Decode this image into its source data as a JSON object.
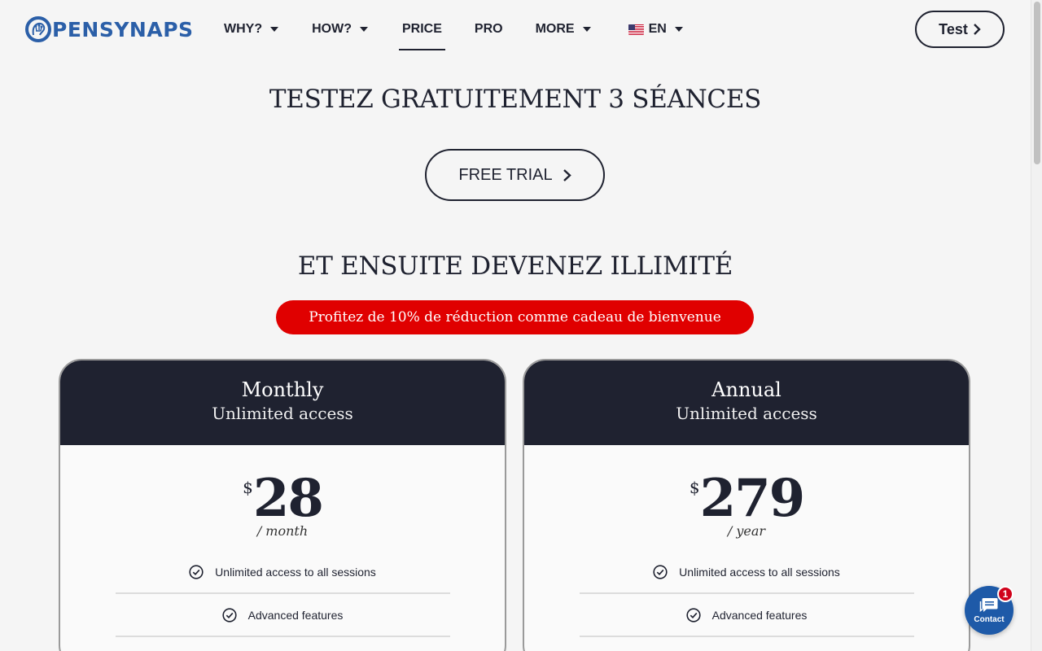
{
  "brand": {
    "name": "PENSYNAPS",
    "logo_letter": "O",
    "color": "#2b5fa8"
  },
  "nav": {
    "items": [
      {
        "label": "WHY?",
        "dropdown": true
      },
      {
        "label": "HOW?",
        "dropdown": true
      },
      {
        "label": "PRICE",
        "active": true
      },
      {
        "label": "PRO"
      },
      {
        "label": "MORE",
        "dropdown": true
      }
    ],
    "language": "EN",
    "language_flag": "us-flag-icon"
  },
  "header_button": {
    "label": "Test"
  },
  "hero": {
    "title": "TESTEZ GRATUITEMENT 3 SÉANCES",
    "cta": "FREE TRIAL",
    "subtitle": "ET ENSUITE DEVENEZ ILLIMITÉ",
    "promo": "Profitez de 10% de réduction comme cadeau de bienvenue",
    "promo_color": "#e00000"
  },
  "plans": [
    {
      "name": "Monthly",
      "subtitle": "Unlimited access",
      "currency": "$",
      "price": "28",
      "period": "/ month",
      "features": [
        "Unlimited access to all sessions",
        "Advanced features"
      ]
    },
    {
      "name": "Annual",
      "subtitle": "Unlimited access",
      "currency": "$",
      "price": "279",
      "period": "/ year",
      "features": [
        "Unlimited access to all sessions",
        "Advanced features"
      ]
    }
  ],
  "contact": {
    "label": "Contact",
    "badge": "1",
    "color": "#1e5aa8"
  },
  "colors": {
    "dark": "#1f2230",
    "background": "#f5f5f5"
  }
}
